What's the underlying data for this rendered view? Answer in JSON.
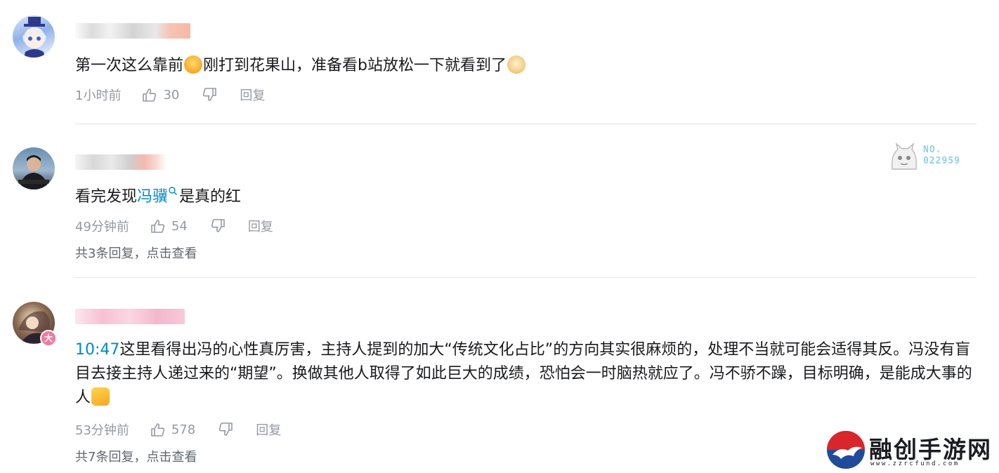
{
  "comments": [
    {
      "text_before": "第一次这么靠前",
      "text_middle": "刚打到花果山，准备看b站放松一下就看到了",
      "time": "1小时前",
      "likes": "30",
      "reply_label": "回复"
    },
    {
      "text_before": "看完发现",
      "keyword": "冯骥",
      "text_after": "是真的红",
      "time": "49分钟前",
      "likes": "54",
      "reply_label": "回复",
      "replies_summary": "共3条回复，点击查看",
      "badge_no_label": "NO.",
      "badge_number": "022959"
    },
    {
      "timestamp_link": "10:47",
      "text": "这里看得出冯的心性真厉害，主持人提到的加大“传统文化占比”的方向其实很麻烦的，处理不当就可能会适得其反。冯没有盲目去接主持人递过来的“期望”。换做其他人取得了如此巨大的成绩，恐怕会一时脑热就应了。冯不骄不躁，目标明确，是能成大事的人",
      "time": "53分钟前",
      "likes": "578",
      "reply_label": "回复",
      "replies_summary": "共7条回复，点击查看",
      "level_badge": "大"
    }
  ],
  "watermark": {
    "name": "融创手游网",
    "url": "www.zzrcfund.com"
  },
  "colors": {
    "link_blue": "#008ac5",
    "meta_gray": "#9499a0",
    "divider": "#e3e5e7",
    "logo_red": "#d9262a",
    "logo_blue": "#1f4b9a"
  },
  "icons": [
    "like-icon",
    "dislike-icon",
    "search-icon",
    "shocked-emoji",
    "doge-emoji",
    "thumbs-up-emoji"
  ]
}
